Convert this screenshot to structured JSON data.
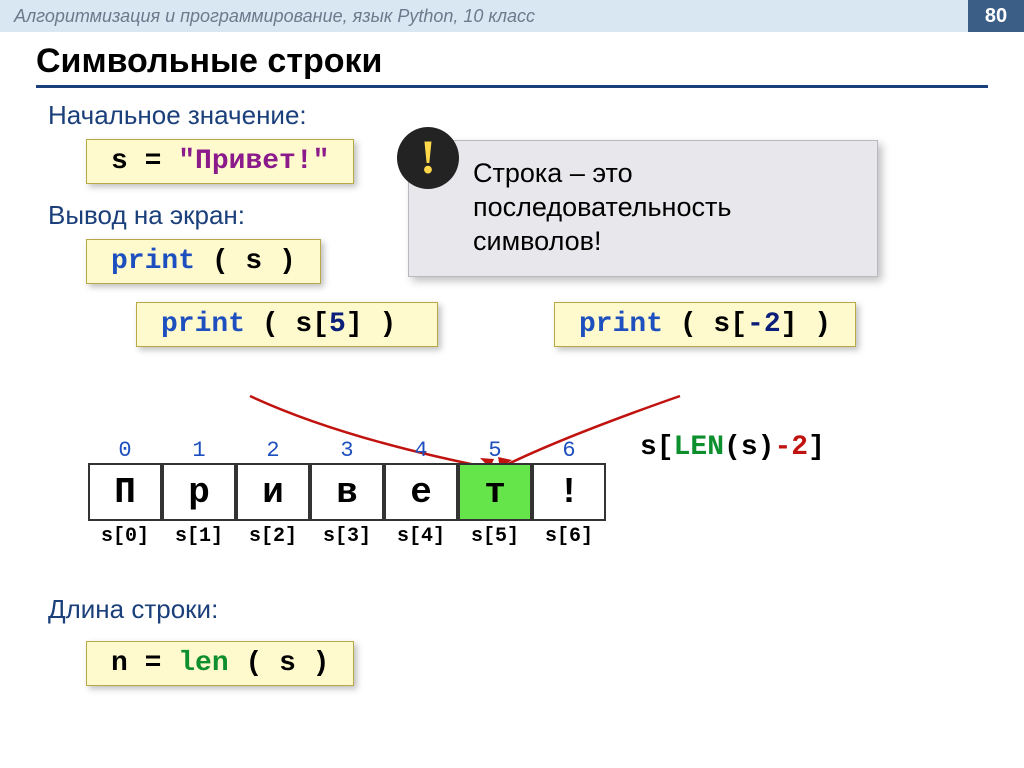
{
  "header": {
    "breadcrumb": "Алгоритмизация и программирование, язык Python, 10 класс",
    "page_number": "80"
  },
  "title": "Символьные строки",
  "sections": {
    "initial": "Начальное значение:",
    "output": "Вывод на экран:",
    "length": "Длина строки:"
  },
  "code": {
    "assign_var": "s",
    "assign_eq": " = ",
    "assign_str": "\"Привет!\"",
    "print_kw": "print",
    "print1": " ( s )",
    "print2_pre": " ( s[",
    "print2_idx": "5",
    "print2_post": "] ) ",
    "print3_pre": " ( s[",
    "print3_idx": "-2",
    "print3_post": "] )",
    "len_var": "n",
    "len_eq": " = ",
    "len_fn": "len",
    "len_arg": " ( s )"
  },
  "callout": {
    "mark": "!",
    "text": "Строка – это последовательность символов!"
  },
  "table": {
    "indices": [
      "0",
      "1",
      "2",
      "3",
      "4",
      "5",
      "6"
    ],
    "chars": [
      "П",
      "р",
      "и",
      "в",
      "е",
      "т",
      "!"
    ],
    "highlight_index": 5,
    "exprs": [
      "s[0]",
      "s[1]",
      "s[2]",
      "s[3]",
      "s[4]",
      "s[5]",
      "s[6]"
    ]
  },
  "len_expr": {
    "pre": "s[",
    "len_kw": "LEN",
    "mid": "(s)",
    "minus": "-2",
    "post": "]"
  }
}
